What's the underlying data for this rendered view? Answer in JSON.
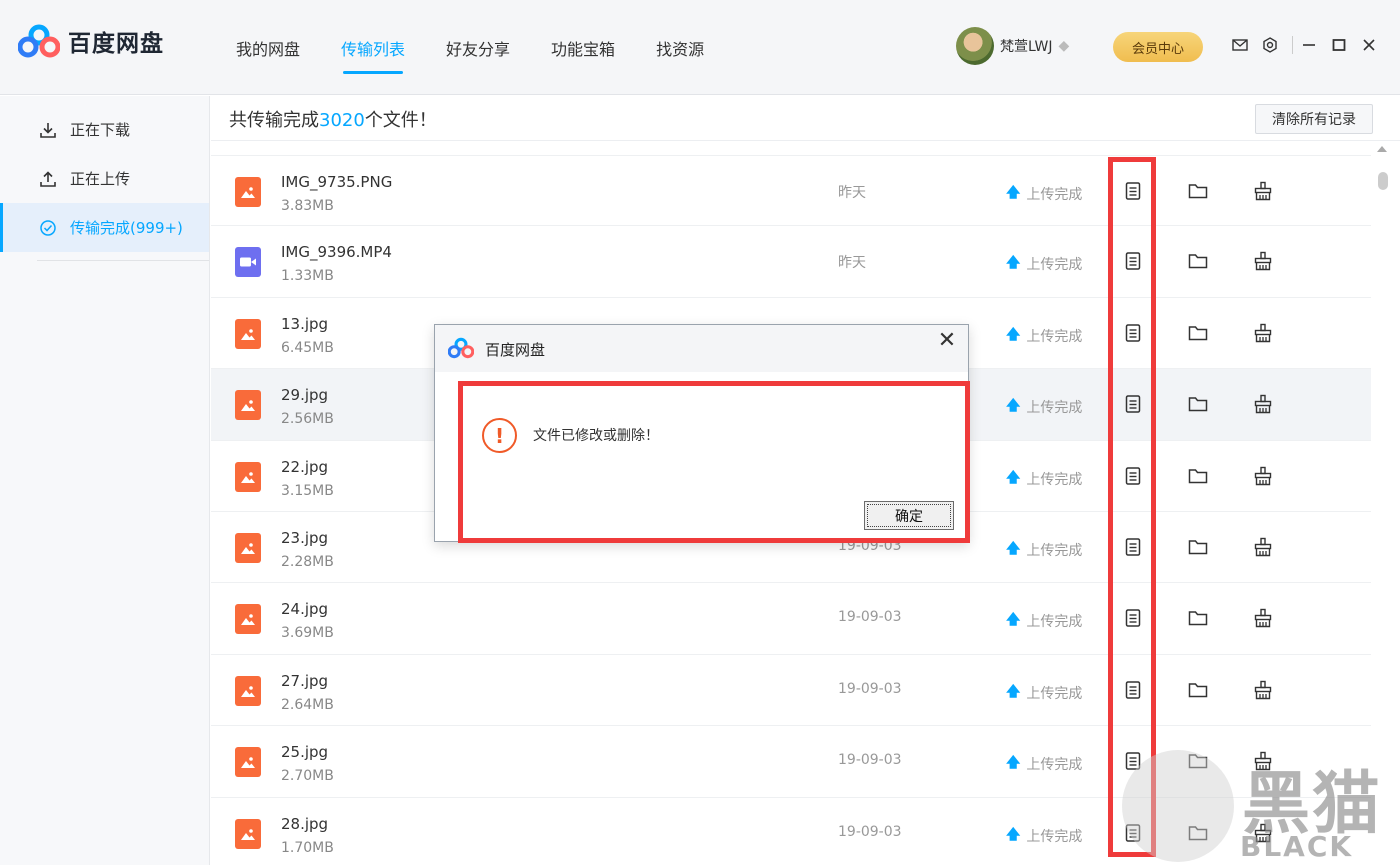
{
  "app": {
    "logo_text": "百度网盘"
  },
  "header": {
    "tabs": [
      {
        "label": "我的网盘",
        "active": false
      },
      {
        "label": "传输列表",
        "active": true
      },
      {
        "label": "好友分享",
        "active": false
      },
      {
        "label": "功能宝箱",
        "active": false
      },
      {
        "label": "找资源",
        "active": false
      }
    ],
    "username": "梵萱LWJ",
    "vip_label": "会员中心"
  },
  "sidebar": {
    "items": [
      {
        "label": "正在下载",
        "icon": "download-icon"
      },
      {
        "label": "正在上传",
        "icon": "upload-icon"
      },
      {
        "label": "传输完成(999+)",
        "icon": "check-circle-icon"
      }
    ]
  },
  "main": {
    "summary_prefix": "共传输完成",
    "summary_count": "3020",
    "summary_suffix": "个文件！",
    "clear_label": "清除所有记录",
    "files": [
      {
        "name": "IMG_9735.PNG",
        "size": "3.83MB",
        "date": "昨天",
        "status": "上传完成",
        "type": "image"
      },
      {
        "name": "IMG_9396.MP4",
        "size": "1.33MB",
        "date": "昨天",
        "status": "上传完成",
        "type": "video"
      },
      {
        "name": "13.jpg",
        "size": "6.45MB",
        "date": "",
        "status": "上传完成",
        "type": "image"
      },
      {
        "name": "29.jpg",
        "size": "2.56MB",
        "date": "",
        "status": "上传完成",
        "type": "image"
      },
      {
        "name": "22.jpg",
        "size": "3.15MB",
        "date": "",
        "status": "上传完成",
        "type": "image"
      },
      {
        "name": "23.jpg",
        "size": "2.28MB",
        "date": "19-09-03",
        "status": "上传完成",
        "type": "image"
      },
      {
        "name": "24.jpg",
        "size": "3.69MB",
        "date": "19-09-03",
        "status": "上传完成",
        "type": "image"
      },
      {
        "name": "27.jpg",
        "size": "2.64MB",
        "date": "19-09-03",
        "status": "上传完成",
        "type": "image"
      },
      {
        "name": "25.jpg",
        "size": "2.70MB",
        "date": "19-09-03",
        "status": "上传完成",
        "type": "image"
      },
      {
        "name": "28.jpg",
        "size": "1.70MB",
        "date": "19-09-03",
        "status": "上传完成",
        "type": "image"
      }
    ]
  },
  "dialog": {
    "title": "百度网盘",
    "message": "文件已修改或删除！",
    "ok_label": "确定"
  },
  "watermark": {
    "cn": "黑猫",
    "en": "BLACK CAT"
  },
  "colors": {
    "accent": "#06a7ff",
    "highlight_red": "#ef3b3b",
    "image_icon": "#f96b3a",
    "video_icon": "#6e6ff0",
    "warning": "#f05a28"
  }
}
